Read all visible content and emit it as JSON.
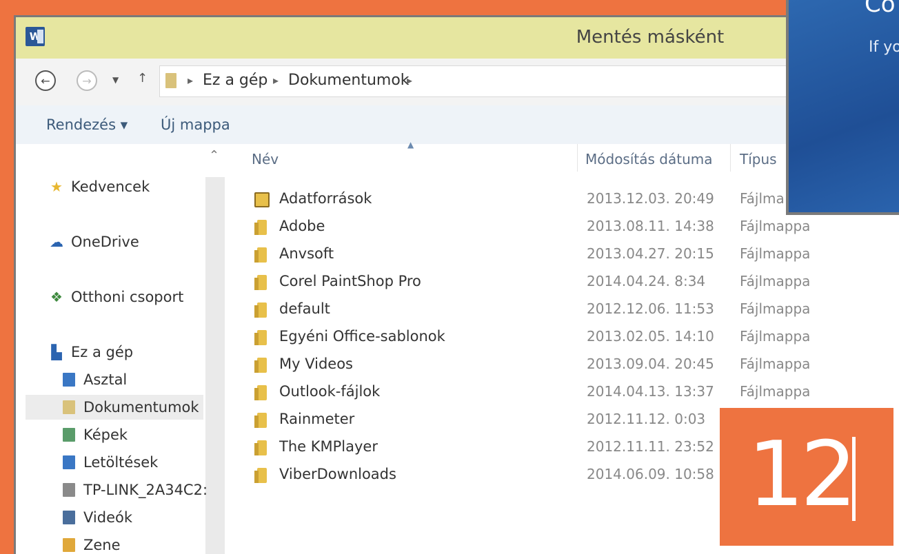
{
  "window": {
    "title": "Mentés másként",
    "app_icon": "W"
  },
  "address": {
    "crumbs": [
      "Ez a gép",
      "Dokumentumok"
    ]
  },
  "toolbar": {
    "organize_label": "Rendezés ▾",
    "new_folder_label": "Új mappa"
  },
  "nav": {
    "favorites": "Kedvencek",
    "onedrive": "OneDrive",
    "homegroup": "Otthoni csoport",
    "this_pc": "Ez a gép",
    "items": [
      "Asztal",
      "Dokumentumok",
      "Képek",
      "Letöltések",
      "TP-LINK_2A34C2:",
      "Videók",
      "Zene"
    ],
    "selected": "Dokumentumok"
  },
  "columns": {
    "name": "Név",
    "date": "Módosítás dátuma",
    "type": "Típus"
  },
  "files": [
    {
      "name": "Adatforrások",
      "date": "2013.12.03. 20:49",
      "type": "Fájlma"
    },
    {
      "name": "Adobe",
      "date": "2013.08.11. 14:38",
      "type": "Fájlmappa"
    },
    {
      "name": "Anvsoft",
      "date": "2013.04.27. 20:15",
      "type": "Fájlmappa"
    },
    {
      "name": "Corel PaintShop Pro",
      "date": "2014.04.24. 8:34",
      "type": "Fájlmappa"
    },
    {
      "name": "default",
      "date": "2012.12.06. 11:53",
      "type": "Fájlmappa"
    },
    {
      "name": "Egyéni Office-sablonok",
      "date": "2013.02.05. 14:10",
      "type": "Fájlmappa"
    },
    {
      "name": "My Videos",
      "date": "2013.09.04. 20:45",
      "type": "Fájlmappa"
    },
    {
      "name": "Outlook-fájlok",
      "date": "2014.04.13. 13:37",
      "type": "Fájlmappa"
    },
    {
      "name": "Rainmeter",
      "date": "2012.11.12. 0:03",
      "type": ""
    },
    {
      "name": "The KMPlayer",
      "date": "2012.11.11. 23:52",
      "type": ""
    },
    {
      "name": "ViberDownloads",
      "date": "2014.06.09. 10:58",
      "type": ""
    }
  ],
  "side_panel": {
    "heading": "Co",
    "text": "If yo"
  },
  "badge": {
    "number": "12"
  },
  "colors": {
    "background": "#ee7340",
    "titlebar": "#e6e6a0",
    "folder": "#e8c04a"
  }
}
